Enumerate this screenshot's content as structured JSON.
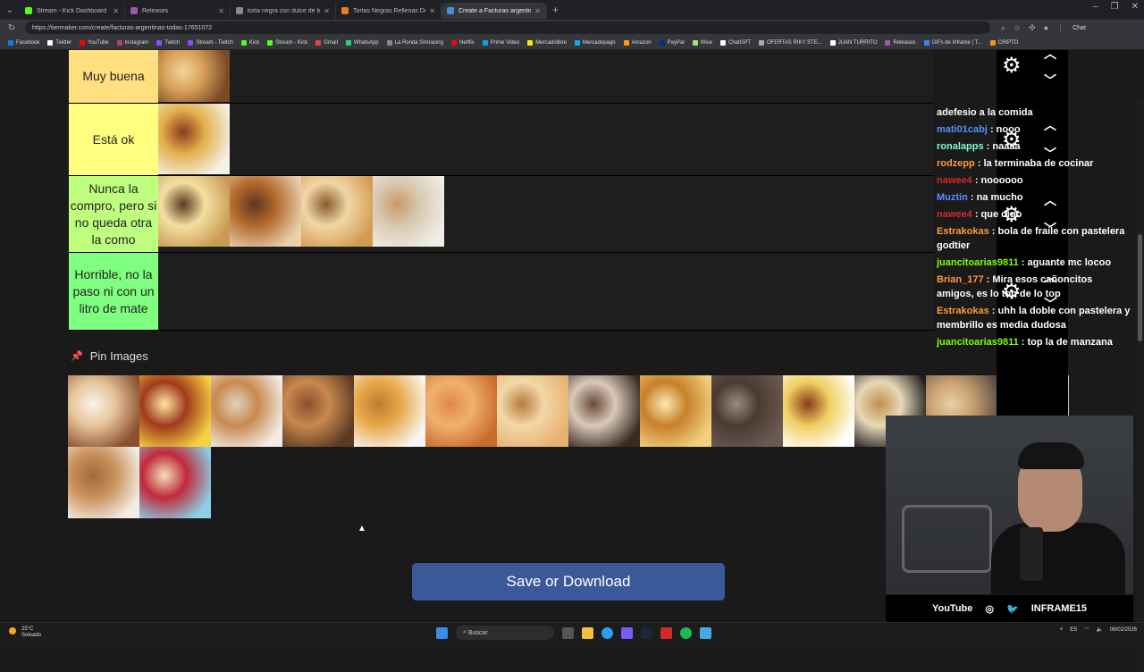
{
  "browser": {
    "tabs": [
      {
        "title": "Stream - Kick Dashboard",
        "color": "#53fc18"
      },
      {
        "title": "Releases",
        "color": "#9b59b6"
      },
      {
        "title": "torta negra con dulce de leche - B",
        "color": "#888888"
      },
      {
        "title": "Tortas Negras Rellenas De Dulce D",
        "color": "#e67e22"
      },
      {
        "title": "Create a Facturas argentinas (TOD",
        "color": "#4a90d9",
        "active": true
      }
    ],
    "url": "https://tiermaker.com/create/facturas-argentinas-todas-17651072",
    "chat_button": "Chat",
    "bookmarks": [
      {
        "label": "Facebook",
        "color": "#1877f2"
      },
      {
        "label": "Twitter",
        "color": "#ffffff"
      },
      {
        "label": "YouTube",
        "color": "#ff0000"
      },
      {
        "label": "Instagram",
        "color": "#c13584"
      },
      {
        "label": "Twitch",
        "color": "#9146ff"
      },
      {
        "label": "Stream - Twitch",
        "color": "#9146ff"
      },
      {
        "label": "Kick",
        "color": "#53fc18"
      },
      {
        "label": "Stream - Kick",
        "color": "#53fc18"
      },
      {
        "label": "Gmail",
        "color": "#ea4335"
      },
      {
        "label": "WhatsApp",
        "color": "#25d366"
      },
      {
        "label": "La Ronda Simracing",
        "color": "#888888"
      },
      {
        "label": "Netflix",
        "color": "#e50914"
      },
      {
        "label": "Prime Video",
        "color": "#00a8e1"
      },
      {
        "label": "Mercadolibre",
        "color": "#ffe600"
      },
      {
        "label": "Mercadopago",
        "color": "#00b1ea"
      },
      {
        "label": "Amazon",
        "color": "#ff9900"
      },
      {
        "label": "PayPal",
        "color": "#003087"
      },
      {
        "label": "Wise",
        "color": "#9fe870"
      },
      {
        "label": "ChatGPT",
        "color": "#ffffff"
      },
      {
        "label": "OFERTAS RIKY STE...",
        "color": "#aaaaaa"
      },
      {
        "label": "JUAN TURRITO",
        "color": "#ffffff"
      },
      {
        "label": "Releases",
        "color": "#9b59b6"
      },
      {
        "label": "GIFs de Inframe | T...",
        "color": "#3b82f6"
      },
      {
        "label": "CRIPTO",
        "color": "#f7931a"
      }
    ]
  },
  "tiers": [
    {
      "label": "Muy buena",
      "color": "#ffdf80",
      "images": [
        {
          "colors": [
            "#7a4a24",
            "#d9a25a",
            "#f2d5a0"
          ]
        }
      ]
    },
    {
      "label": "Está ok",
      "color": "#ffff7f",
      "images": [
        {
          "colors": [
            "#f5f0e8",
            "#e3b04b",
            "#8a3a1e"
          ]
        }
      ]
    },
    {
      "label": "Nunca la compro, pero si no queda otra la como",
      "color": "#bfff7f",
      "images": [
        {
          "colors": [
            "#c89a52",
            "#f3e0a2",
            "#5a3a1c"
          ]
        },
        {
          "colors": [
            "#e7d1b0",
            "#b56a2c",
            "#5e3520"
          ]
        },
        {
          "colors": [
            "#d39b52",
            "#f1d7a5",
            "#8a5a2c"
          ]
        },
        {
          "colors": [
            "#f0ede6",
            "#d8c9b0",
            "#c89a6a"
          ]
        }
      ]
    },
    {
      "label": "Horrible, no la paso ni con un litro de mate",
      "color": "#7fff7f",
      "images": []
    }
  ],
  "pin_section": {
    "title": "Pin Images",
    "images": [
      {
        "colors": [
          "#8a5030",
          "#e7c59a",
          "#f8f4ee"
        ]
      },
      {
        "colors": [
          "#f5d040",
          "#a03a1c",
          "#fbe8a0"
        ]
      },
      {
        "colors": [
          "#f3ece4",
          "#c88a50",
          "#e2d1bb"
        ]
      },
      {
        "colors": [
          "#5a3a22",
          "#c98850",
          "#8a5030"
        ]
      },
      {
        "colors": [
          "#f8f5f0",
          "#e8a84a",
          "#c07a30"
        ]
      },
      {
        "colors": [
          "#c96a2a",
          "#f0b070",
          "#e08a4a"
        ]
      },
      {
        "colors": [
          "#e8b070",
          "#f2d8a8",
          "#b87a40"
        ]
      },
      {
        "colors": [
          "#3a2a22",
          "#d9c9b9",
          "#6a4a3a"
        ]
      },
      {
        "colors": [
          "#f2d080",
          "#c8802a",
          "#fae8b0"
        ]
      },
      {
        "colors": [
          "#6a5a52",
          "#4a3a32",
          "#9a8a82"
        ]
      },
      {
        "colors": [
          "#ffffff",
          "#f0d060",
          "#8a3a1c"
        ]
      },
      {
        "colors": [
          "#1e1e1e",
          "#e8d8b8",
          "#c0904a"
        ]
      },
      {
        "colors": [
          "#5a4a42",
          "#c8a070",
          "#e8d0a8"
        ]
      },
      {
        "colors": [
          "#d8c8c0",
          "#b07a50",
          "#eee0d0"
        ]
      },
      {
        "colors": [
          "#f3ede4",
          "#c8905a",
          "#a06a3a"
        ]
      },
      {
        "colors": [
          "#8ad0e8",
          "#c02a3a",
          "#f2e0b8"
        ]
      }
    ]
  },
  "save_button": "Save or Download",
  "overlay": {
    "chat": [
      {
        "user": "",
        "user_color": "#ffffff",
        "text": "adefesio a la comida"
      },
      {
        "user": "mati01cabj",
        "user_color": "#5b8fff",
        "text": ": nooo"
      },
      {
        "user": "ronalapps",
        "user_color": "#7fffd4",
        "text": ": naaaa"
      },
      {
        "user": "rodzepp",
        "user_color": "#ff9a3c",
        "text": ": la terminaba de cocinar"
      },
      {
        "user": "nawee4",
        "user_color": "#d12a2a",
        "text": ": noooooo"
      },
      {
        "user": "Muztin",
        "user_color": "#5b8fff",
        "text": ": na mucho"
      },
      {
        "user": "nawee4",
        "user_color": "#d12a2a",
        "text": ": que digo"
      },
      {
        "user": "Estrakokas",
        "user_color": "#ff9a3c",
        "text": ": bola de fraile con pastelera godtier"
      },
      {
        "user": "juancitoarias9811",
        "user_color": "#7fff00",
        "text": ": aguante mc locoo"
      },
      {
        "user": "Brian_177",
        "user_color": "#ff9a3c",
        "text": ": Mira esos cañoncitos amigos, es lo top de lo top"
      },
      {
        "user": "Estrakokas",
        "user_color": "#ff9a3c",
        "text": ": uhh la doble con pastelera y membrillo es media dudosa"
      },
      {
        "user": "juancitoarias9811",
        "user_color": "#7fff00",
        "text": ": top la de manzana"
      }
    ],
    "social_youtube": "YouTube",
    "social_handle": "INFRAME15"
  },
  "taskbar": {
    "temp": "25°C",
    "weather": "Soleado",
    "search_placeholder": "Buscar",
    "lang": "ES",
    "date": "06/02/2026"
  }
}
